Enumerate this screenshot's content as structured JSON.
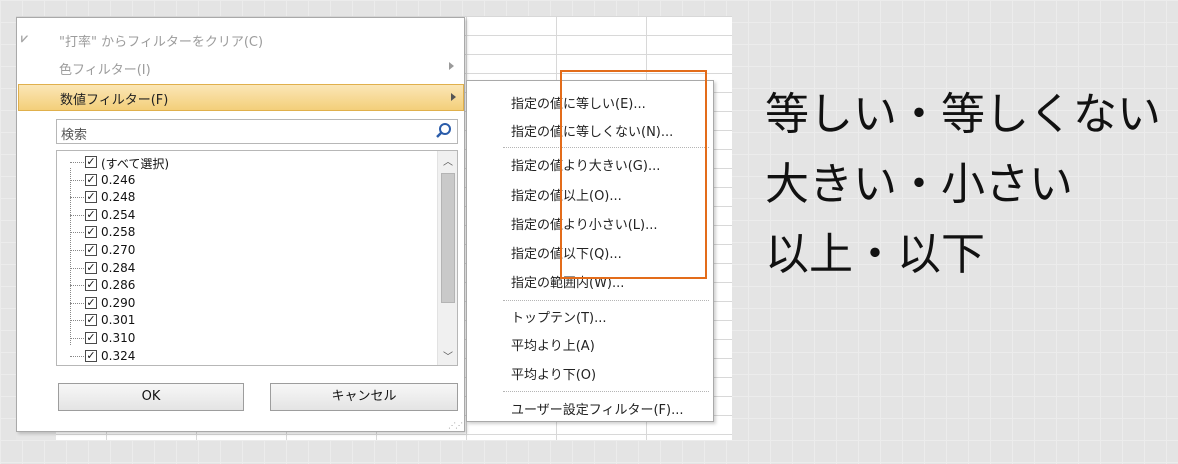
{
  "filter_menu": {
    "clear_filter_label": "\"打率\" からフィルターをクリア(C)",
    "color_filter_label": "色フィルター(I)",
    "number_filter_label": "数値フィルター(F)",
    "search_placeholder": "検索",
    "list_items": [
      "(すべて選択)",
      "0.246",
      "0.248",
      "0.254",
      "0.258",
      "0.270",
      "0.284",
      "0.286",
      "0.290",
      "0.301",
      "0.310",
      "0.324"
    ],
    "ok_label": "OK",
    "cancel_label": "キャンセル"
  },
  "number_filter_submenu": {
    "items": [
      "指定の値に等しい(E)...",
      "指定の値に等しくない(N)...",
      "指定の値より大きい(G)...",
      "指定の値以上(O)...",
      "指定の値より小さい(L)...",
      "指定の値以下(Q)...",
      "指定の範囲内(W)...",
      "トップテン(T)...",
      "平均より上(A)",
      "平均より下(O)",
      "ユーザー設定フィルター(F)..."
    ]
  },
  "callouts": [
    "等しい・等しくない",
    "大きい・小さい",
    "以上・以下"
  ],
  "colors": {
    "highlight_border": "#e36c1a",
    "menu_hover": "#f3cf7a"
  }
}
